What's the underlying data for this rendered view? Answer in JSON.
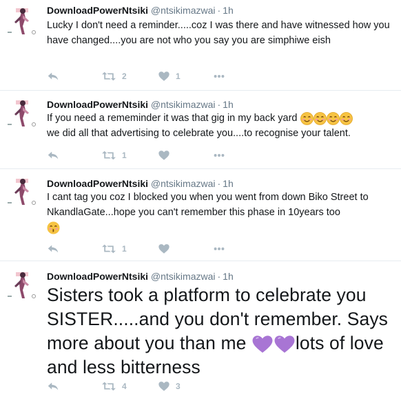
{
  "colors": {
    "text": "#14171a",
    "muted": "#657786",
    "icon": "#aab8c2",
    "divider": "#e6ecf0"
  },
  "tweets": [
    {
      "name": "DownloadPowerNtsiki",
      "handle": "@ntsikimazwai",
      "separator": "·",
      "time": "1h",
      "text": "Lucky I don't need a reminder.....coz I was there and have witnessed how you have changed....you are not who you say you are simphiwe eish",
      "retweets": "2",
      "likes": "1"
    },
    {
      "name": "DownloadPowerNtsiki",
      "handle": "@ntsikimazwai",
      "separator": "·",
      "time": "1h",
      "text_a": "If you need a rememinder it was that gig in my back yard ",
      "text_b": "we did all that advertising to celebrate you....to recognise your talent.",
      "retweets": "1",
      "likes": ""
    },
    {
      "name": "DownloadPowerNtsiki",
      "handle": "@ntsikimazwai",
      "separator": "·",
      "time": "1h",
      "text": "I cant tag you coz I blocked you when you went from down  Biko Street to NkandlaGate...hope you can't  remember this phase in 10years too",
      "retweets": "1",
      "likes": ""
    },
    {
      "name": "DownloadPowerNtsiki",
      "handle": "@ntsikimazwai",
      "separator": "·",
      "time": "1h",
      "text_a": "Sisters took a platform to celebrate you SISTER.....and you don't remember. Says more about you than me ",
      "text_b": "lots of love and less bitterness",
      "retweets": "4",
      "likes": "3"
    }
  ],
  "icons": {
    "reply": "reply-icon",
    "retweet": "retweet-icon",
    "like": "heart-icon",
    "more": "more-icon",
    "smile": "smiling-face-emoji",
    "kiss": "kissing-face-emoji",
    "purple_heart": "purple-heart-emoji"
  }
}
